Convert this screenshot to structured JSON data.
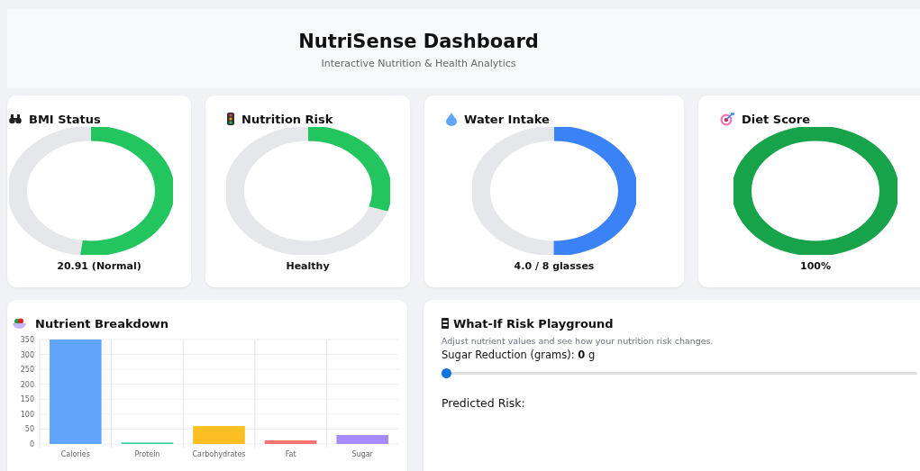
{
  "header": {
    "title": "NutriSense Dashboard",
    "subtitle": "Interactive Nutrition & Health Analytics"
  },
  "gauges": [
    {
      "kind": "scale",
      "title": "BMI Status",
      "level": 0.52,
      "color": "#22c55e",
      "reading": "20.91 (Normal)"
    },
    {
      "kind": "light",
      "title": "Nutrition Risk",
      "level": 0.3,
      "color": "#22c55e",
      "reading": "Healthy"
    },
    {
      "kind": "drop",
      "title": "Water Intake",
      "level": 0.5,
      "color": "#3b82f6",
      "reading": "4.0 / 8 glasses"
    },
    {
      "kind": "target",
      "title": "Diet Score",
      "level": 1,
      "color": "#16a34a",
      "reading": "100%"
    }
  ],
  "nutrients": {
    "title": "Nutrient Breakdown",
    "chart_data": {
      "type": "bar",
      "categories": [
        "Calories",
        "Protein",
        "Carbohydrates",
        "Fat",
        "Sugar"
      ],
      "values": [
        350,
        5,
        60,
        12,
        30
      ],
      "colors": [
        "#60a5fa",
        "#34d399",
        "#fbbf24",
        "#f87171",
        "#a78bfa"
      ],
      "grid": true,
      "ylim": [
        0,
        350
      ],
      "yticks": [
        0,
        50,
        100,
        150,
        200,
        250,
        300,
        350
      ]
    }
  },
  "playground": {
    "title": "What-If Risk Playground",
    "description": "Adjust nutrient values and see how your nutrition risk changes.",
    "slider_label": "Sugar Reduction (grams): **0** g",
    "level": 0,
    "result_label": "Predicted Risk:"
  }
}
